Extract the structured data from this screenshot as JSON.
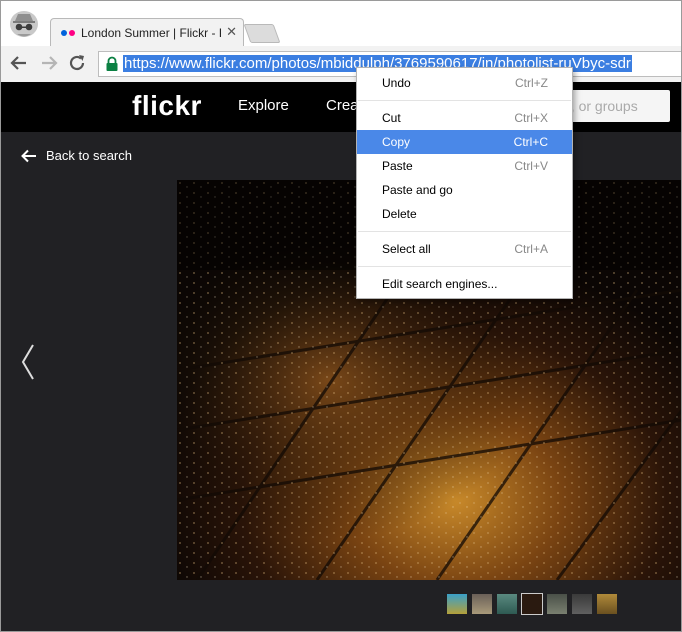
{
  "browser": {
    "tab": {
      "title": "London Summer | Flickr - Photo Sharing!",
      "favicon_colors": [
        "#0063dc",
        "#ff0084"
      ]
    },
    "address_bar": {
      "url": "https://www.flickr.com/photos/mbiddulph/3769590617/in/photolist-ruVbyc-sdr"
    },
    "icons": [
      "incognito-icon",
      "back-arrow-icon",
      "forward-arrow-icon",
      "reload-icon",
      "lock-icon",
      "tab-close-icon"
    ]
  },
  "site": {
    "logo": "flickr",
    "nav": {
      "explore": "Explore",
      "create": "Crea"
    },
    "search_placeholder": "e, or groups",
    "back_link": "Back to search"
  },
  "context_menu": {
    "groups": [
      [
        {
          "label": "Undo",
          "shortcut": "Ctrl+Z"
        }
      ],
      [
        {
          "label": "Cut",
          "shortcut": "Ctrl+X"
        },
        {
          "label": "Copy",
          "shortcut": "Ctrl+C",
          "highlighted": true
        },
        {
          "label": "Paste",
          "shortcut": "Ctrl+V"
        },
        {
          "label": "Paste and go",
          "shortcut": ""
        },
        {
          "label": "Delete",
          "shortcut": ""
        }
      ],
      [
        {
          "label": "Select all",
          "shortcut": "Ctrl+A"
        }
      ],
      [
        {
          "label": "Edit search engines...",
          "shortcut": ""
        }
      ]
    ]
  },
  "colors": {
    "highlight": "#4a88e8",
    "selection": "#3b7ee1",
    "page_bg": "#212124"
  }
}
